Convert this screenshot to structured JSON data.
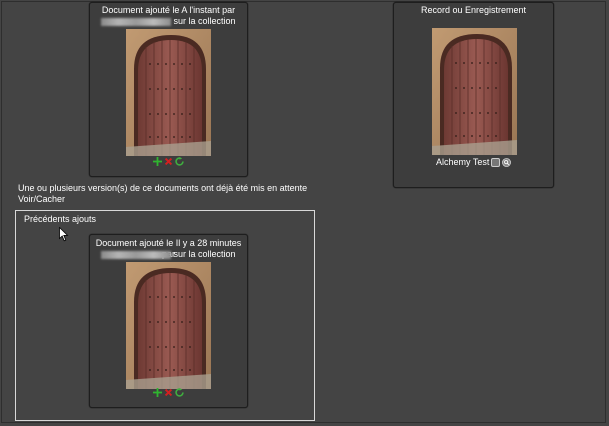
{
  "card1": {
    "caption_line1": "Document ajouté le A l'instant par",
    "caption_line2_suffix": "sur la collection",
    "actions": [
      "add-icon",
      "delete-icon",
      "refresh-icon"
    ]
  },
  "record": {
    "title": "Record ou Enregistrement",
    "label": "Alchemy Test",
    "actions": [
      "info-icon",
      "zoom-icon"
    ]
  },
  "notice": {
    "message": "Une ou plusieurs version(s) de ce documents ont déjà été mis en attente",
    "toggle_link": "Voir/Cacher"
  },
  "previous": {
    "title": "Précédents ajouts",
    "card": {
      "caption_line1": "Document ajouté le Il y a 28 minutes par",
      "caption_line2_suffix": "sur la collection",
      "actions": [
        "add-icon",
        "delete-icon",
        "refresh-icon"
      ]
    }
  },
  "colors": {
    "background": "#444444",
    "text": "#ffffff",
    "add": "#2fb52f",
    "delete": "#d22020",
    "refresh": "#3fae3f"
  }
}
